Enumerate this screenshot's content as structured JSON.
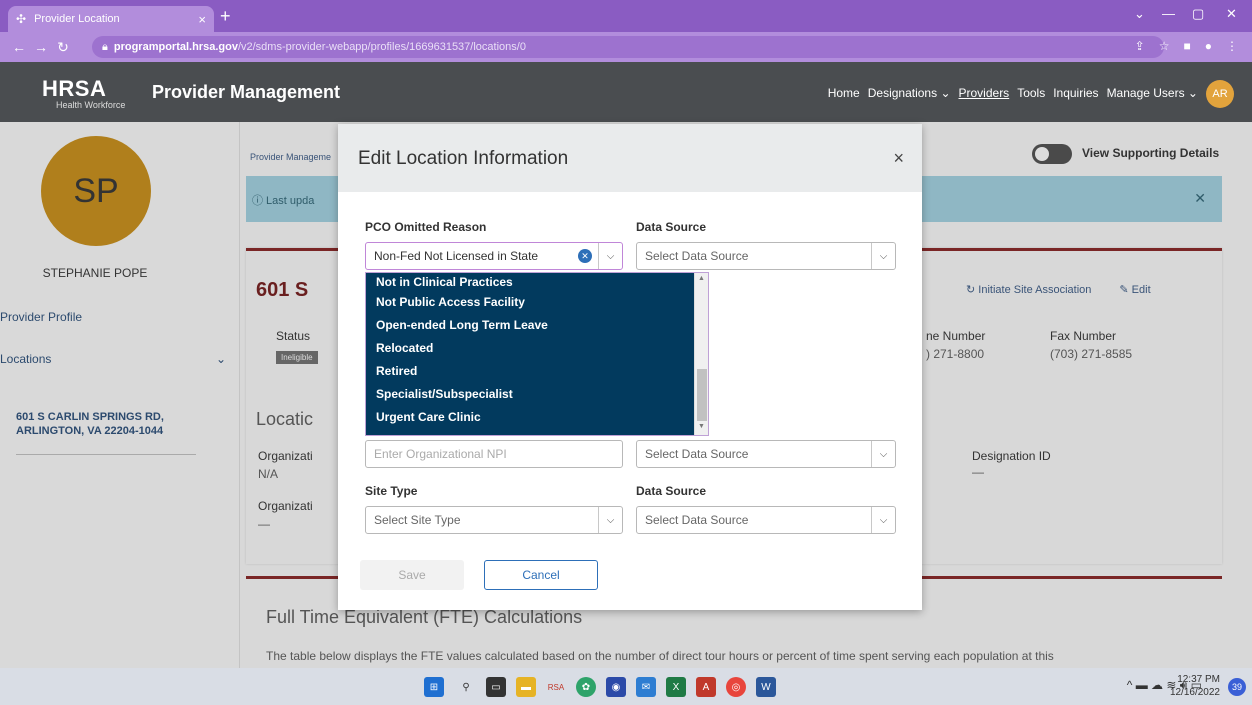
{
  "browser": {
    "tab_title": "Provider Location",
    "tab_close": "×",
    "new_tab": "+",
    "url_host": "programportal.hrsa.gov",
    "url_path": "/v2/sdms-provider-webapp/profiles/1669631537/locations/0"
  },
  "header": {
    "logo": "HRSA",
    "logo_sub": "Health Workforce",
    "app_name": "Provider Management",
    "nav": [
      "Home",
      "Designations ⌄",
      "Providers",
      "Tools",
      "Inquiries",
      "Manage Users ⌄"
    ],
    "avatar_initials": "AR"
  },
  "sidebar": {
    "initials": "SP",
    "name": "STEPHANIE POPE",
    "provider_profile": "Provider Profile",
    "locations": "Locations",
    "location_address": "601 S CARLIN SPRINGS RD, ARLINGTON, VA 22204-1044"
  },
  "main": {
    "breadcrumb": "Provider Manageme",
    "view_supporting_details": "View Supporting Details",
    "banner_text": "ⓘ Last upda",
    "card_title": "601 S",
    "initiate_site_association": "↻  Initiate Site Association",
    "edit": "✎  Edit",
    "status_label": "Status",
    "status_badge": "Ineligible",
    "phone_label": "ne Number",
    "phone_value": ") 271-8800",
    "fax_label": "Fax Number",
    "fax_value": "(703) 271-8585",
    "location_heading": "Locatic",
    "org_label_1": "Organizati",
    "org_value_1": "N/A",
    "org_label_2": "Organizati",
    "org_value_2": "—",
    "designation_label": "Designation ID",
    "designation_value": "—",
    "fte_title": "Full Time Equivalent (FTE) Calculations",
    "fte_text": "The table below displays the FTE values calculated based on the number of direct tour hours or percent of time spent serving each population at this"
  },
  "modal": {
    "title": "Edit Location Information",
    "close": "×",
    "pco_label": "PCO Omitted Reason",
    "pco_value": "Non-Fed Not Licensed in State",
    "data_source_label": "Data Source",
    "data_source_placeholder": "Select Data Source",
    "org_npi_placeholder": "Enter Organizational NPI",
    "site_type_label": "Site Type",
    "site_type_placeholder": "Select Site Type",
    "save": "Save",
    "cancel": "Cancel",
    "dropdown_options": [
      "Not in Clinical Practices",
      "Not Public Access Facility",
      "Open-ended Long Term Leave",
      "Relocated",
      "Retired",
      "Specialist/Subspecialist",
      "Urgent Care Clinic"
    ]
  },
  "taskbar": {
    "time": "12:37 PM",
    "date": "12/16/2022",
    "notifications": "39",
    "rsa_label": "RSA"
  }
}
